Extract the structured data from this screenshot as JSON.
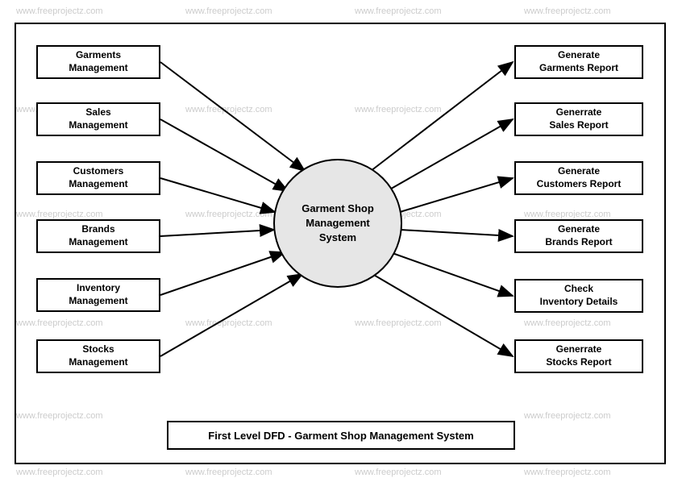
{
  "diagram": {
    "center": "Garment Shop\nManagement\nSystem",
    "caption": "First Level DFD - Garment Shop Management System",
    "left_entities": [
      "Garments\nManagement",
      "Sales\nManagement",
      "Customers\nManagement",
      "Brands\nManagement",
      "Inventory\nManagement",
      "Stocks\nManagement"
    ],
    "right_entities": [
      "Generate\nGarments Report",
      "Generrate\nSales Report",
      "Generate\nCustomers Report",
      "Generate\nBrands Report",
      "Check\nInventory Details",
      "Generrate\nStocks Report"
    ],
    "watermark_text": "www.freeprojectz.com"
  }
}
